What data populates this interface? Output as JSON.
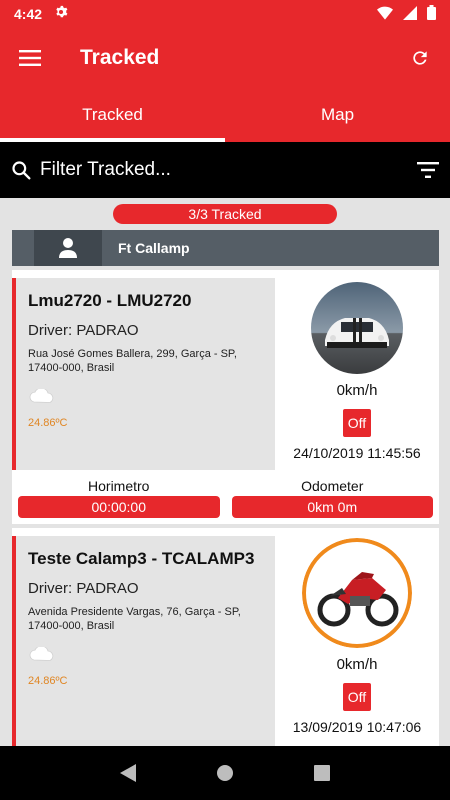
{
  "status_bar": {
    "time": "4:42"
  },
  "app_bar": {
    "title": "Tracked"
  },
  "tabs": [
    {
      "label": "Tracked",
      "active": true
    },
    {
      "label": "Map",
      "active": false
    }
  ],
  "filter": {
    "placeholder": "Filter Tracked..."
  },
  "summary": {
    "count_label": "3/3 Tracked"
  },
  "group": {
    "name": "Ft Callamp"
  },
  "vehicles": [
    {
      "name": "Lmu2720 - LMU2720",
      "driver": "Driver: PADRAO",
      "address": "Rua José Gomes Ballera, 299, Garça - SP, 17400-000, Brasil",
      "temperature": "24.86ºC",
      "speed": "0km/h",
      "ignition": "Off",
      "datetime": "24/10/2019 11:45:56",
      "metrics": [
        {
          "label": "Horimetro",
          "value": "00:00:00"
        },
        {
          "label": "Odometer",
          "value": "0km 0m"
        }
      ]
    },
    {
      "name": "Teste Calamp3 - TCALAMP3",
      "driver": "Driver: PADRAO",
      "address": "Avenida Presidente Vargas, 76, Garça - SP, 17400-000, Brasil",
      "temperature": "24.86ºC",
      "speed": "0km/h",
      "ignition": "Off",
      "datetime": "13/09/2019 10:47:06"
    }
  ],
  "colors": {
    "primary": "#e7282c",
    "temperature": "#e08624",
    "group_header": "#555e66"
  }
}
